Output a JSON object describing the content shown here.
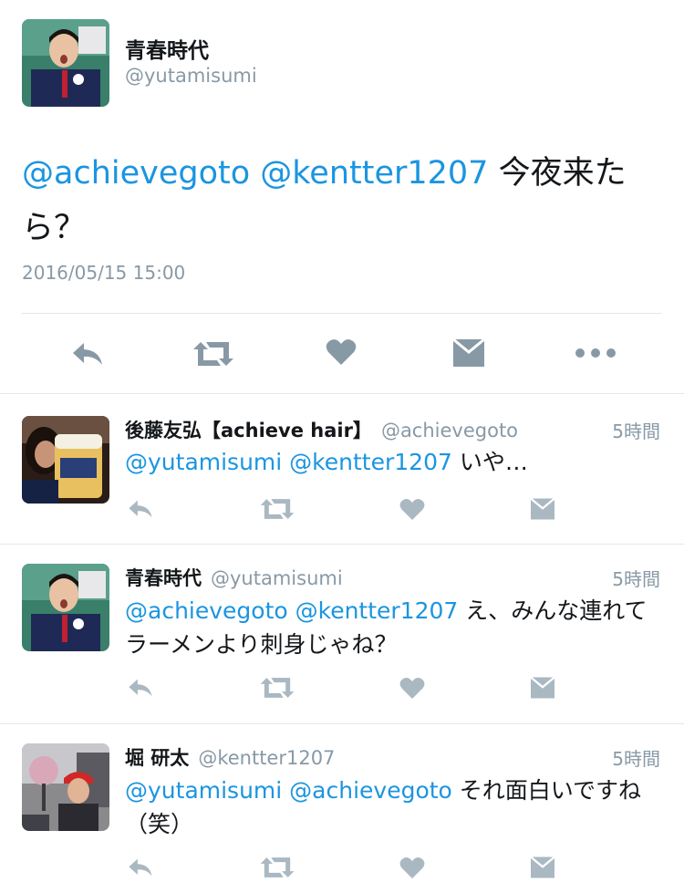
{
  "main_tweet": {
    "name": "青春時代",
    "handle": "@yutamisumi",
    "text_mentions": "@achievegoto @kentter1207",
    "text_body": " 今夜来たら？",
    "timestamp": "2016/05/15 15:00",
    "actions": [
      "reply-icon",
      "retweet-icon",
      "like-icon",
      "dm-icon",
      "more-icon"
    ]
  },
  "replies": [
    {
      "name": "後藤友弘【achieve hair】",
      "handle": "@achievegoto",
      "time": "5時間",
      "mentions": "@yutamisumi @kentter1207",
      "body": " いや…"
    },
    {
      "name": "青春時代",
      "handle": "@yutamisumi",
      "time": "5時間",
      "mentions": "@achievegoto @kentter1207",
      "body": " え、みんな連れてラーメンより刺身じゃね？"
    },
    {
      "name": "堀 研太",
      "handle": "@kentter1207",
      "time": "5時間",
      "mentions": "@yutamisumi @achievegoto",
      "body": " それ面白いですね（笑）"
    }
  ],
  "colors": {
    "link": "#1b95e0",
    "secondary": "#8899a6",
    "icon": "#aab8c2",
    "divider": "#e1e8ed"
  }
}
